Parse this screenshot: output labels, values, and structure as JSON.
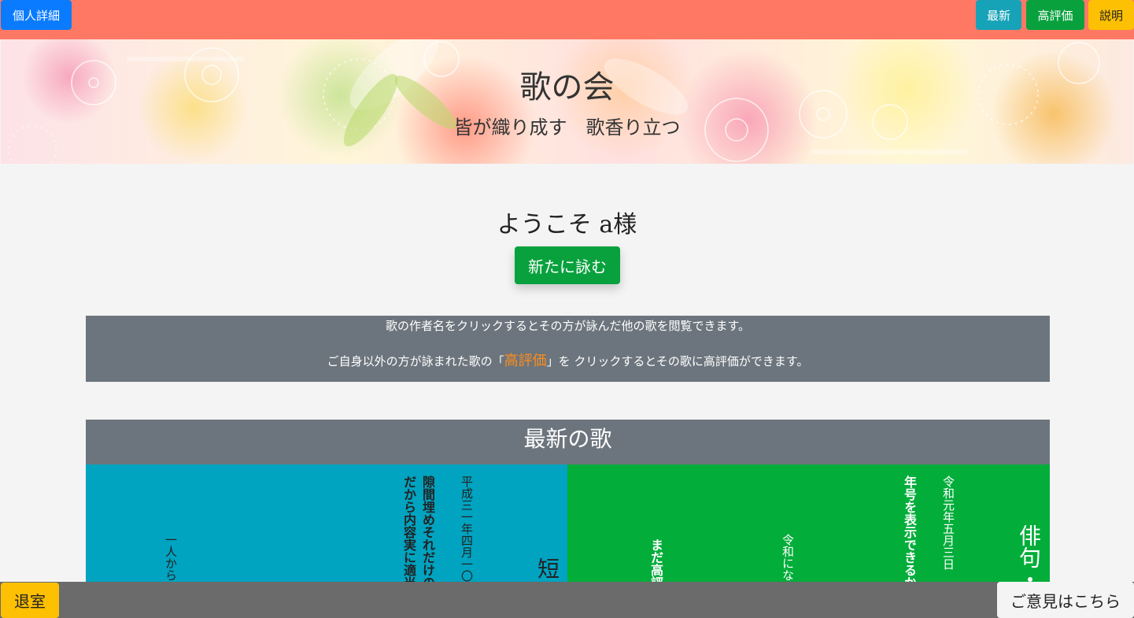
{
  "topbar": {
    "detail_label": "個人詳細",
    "latest_label": "最新",
    "top_rated_label": "高評価",
    "help_label": "説明"
  },
  "banner": {
    "title": "歌の会",
    "subtitle": "皆が織り成す　歌香り立つ"
  },
  "welcome": {
    "text": "ようこそ a様",
    "compose_label": "新たに詠む"
  },
  "info": {
    "line1": "歌の作者名をクリックするとその方が詠んだ他の歌を閲覧できます。",
    "line2_prefix": "ご自身以外の方が詠まれた歌の「",
    "line2_highlight": "高評価",
    "line2_suffix": "」を クリックするとその歌に高評価ができます。"
  },
  "latest": {
    "heading": "最新の歌",
    "cards": [
      {
        "kind": "短",
        "date": "平成三一年四月一〇",
        "lines": [
          "隙間埋めそれだけの",
          "だから内容実に適当"
        ],
        "author_partial": "一人から"
      },
      {
        "kind": "俳句・",
        "date": "令和元年五月三日",
        "lines": [
          "年号を表示できるか"
        ],
        "author_partial": "令和にな",
        "rating_partial": "まだ高評"
      }
    ]
  },
  "footer": {
    "exit_label": "退室",
    "feedback_label": "ご意見はこちら"
  },
  "colors": {
    "topbar": "#ff7864",
    "primary": "#0a7bff",
    "info": "#16a3b8",
    "success": "#08a13e",
    "warning": "#fec003",
    "secondary": "#6c757d",
    "highlight": "#ff8c1a"
  }
}
